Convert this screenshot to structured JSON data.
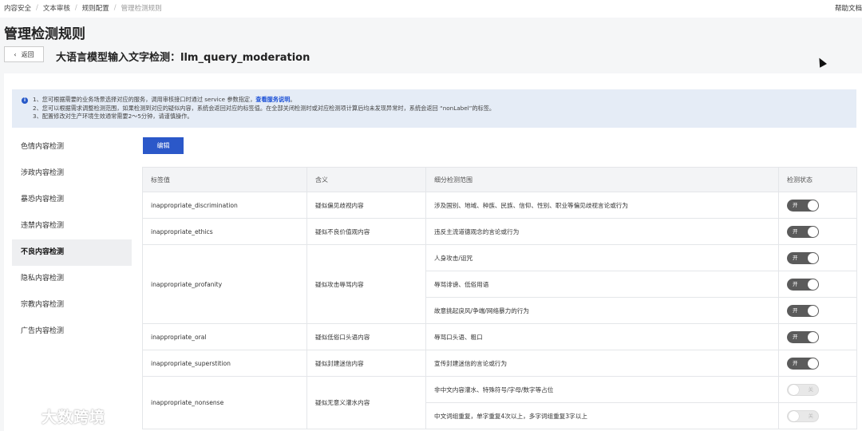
{
  "breadcrumb": [
    "内容安全",
    "文本审核",
    "规则配置",
    "管理检测规则"
  ],
  "help": "帮助文档",
  "page_title": "管理检测规则",
  "back_label": "返回",
  "rule_title": "大语言模型输入文字检测：llm_query_moderation",
  "notice": {
    "line1_pre": "1、您可根据需要的业务场景选择对应的服务，调用审核接口时通过 service 参数指定，",
    "line1_link": "查看服务说明",
    "line1_post": "。",
    "line2": "2、您可以根据需求调整检测范围，如果检测到对应的疑似内容，系统会返回对应的标签值。在全部关闭检测时或对应检测项计算后均未发现异常时，系统会返回 “nonLabel”的标签。",
    "line3": "3、配置修改对生产环境生效通常需要2～5分钟，请谨慎操作。"
  },
  "sidebar": {
    "items": [
      {
        "label": "色情内容检测"
      },
      {
        "label": "涉政内容检测"
      },
      {
        "label": "暴恐内容检测"
      },
      {
        "label": "违禁内容检测"
      },
      {
        "label": "不良内容检测",
        "active": true
      },
      {
        "label": "隐私内容检测"
      },
      {
        "label": "宗教内容检测"
      },
      {
        "label": "广告内容检测"
      }
    ]
  },
  "edit_label": "编辑",
  "table": {
    "headers": [
      "标签值",
      "含义",
      "细分检测范围",
      "检测状态"
    ],
    "groups": [
      {
        "label": "inappropriate_discrimination",
        "meaning": "疑似偏见歧视内容",
        "subs": [
          {
            "scope": "涉及国别、地域、种族、民族、信仰、性别、职业等偏见歧视言论或行为",
            "status": "开",
            "on": true
          }
        ]
      },
      {
        "label": "inappropriate_ethics",
        "meaning": "疑似不良价值观内容",
        "subs": [
          {
            "scope": "违反主流道德观念的言论或行为",
            "status": "开",
            "on": true
          }
        ]
      },
      {
        "label": "inappropriate_profanity",
        "meaning": "疑似攻击辱骂内容",
        "subs": [
          {
            "scope": "人身攻击/诅咒",
            "status": "开",
            "on": true
          },
          {
            "scope": "辱骂诽谤、低俗用语",
            "status": "开",
            "on": true
          },
          {
            "scope": "故意挑起戾风/争端/网络暴力的行为",
            "status": "开",
            "on": true
          }
        ]
      },
      {
        "label": "inappropriate_oral",
        "meaning": "疑似低俗口头语内容",
        "subs": [
          {
            "scope": "辱骂口头语、粗口",
            "status": "开",
            "on": true
          }
        ]
      },
      {
        "label": "inappropriate_superstition",
        "meaning": "疑似封建迷信内容",
        "subs": [
          {
            "scope": "宣传封建迷信的言论或行为",
            "status": "开",
            "on": true
          }
        ]
      },
      {
        "label": "inappropriate_nonsense",
        "meaning": "疑似无意义灌水内容",
        "subs": [
          {
            "scope": "非中文内容灌水、特殊符号/字母/数字等占位",
            "status": "关",
            "on": false
          },
          {
            "scope": "中文词组重复，单字重复4次以上，多字词组重复3字以上",
            "status": "关",
            "on": false
          }
        ]
      }
    ]
  },
  "watermark": "大数跨境",
  "colors": {
    "primary": "#2b58c9",
    "notice_bg": "#e5ecf6",
    "toggle_on": "#5b5b5b",
    "toggle_off": "#e8e8e8"
  }
}
